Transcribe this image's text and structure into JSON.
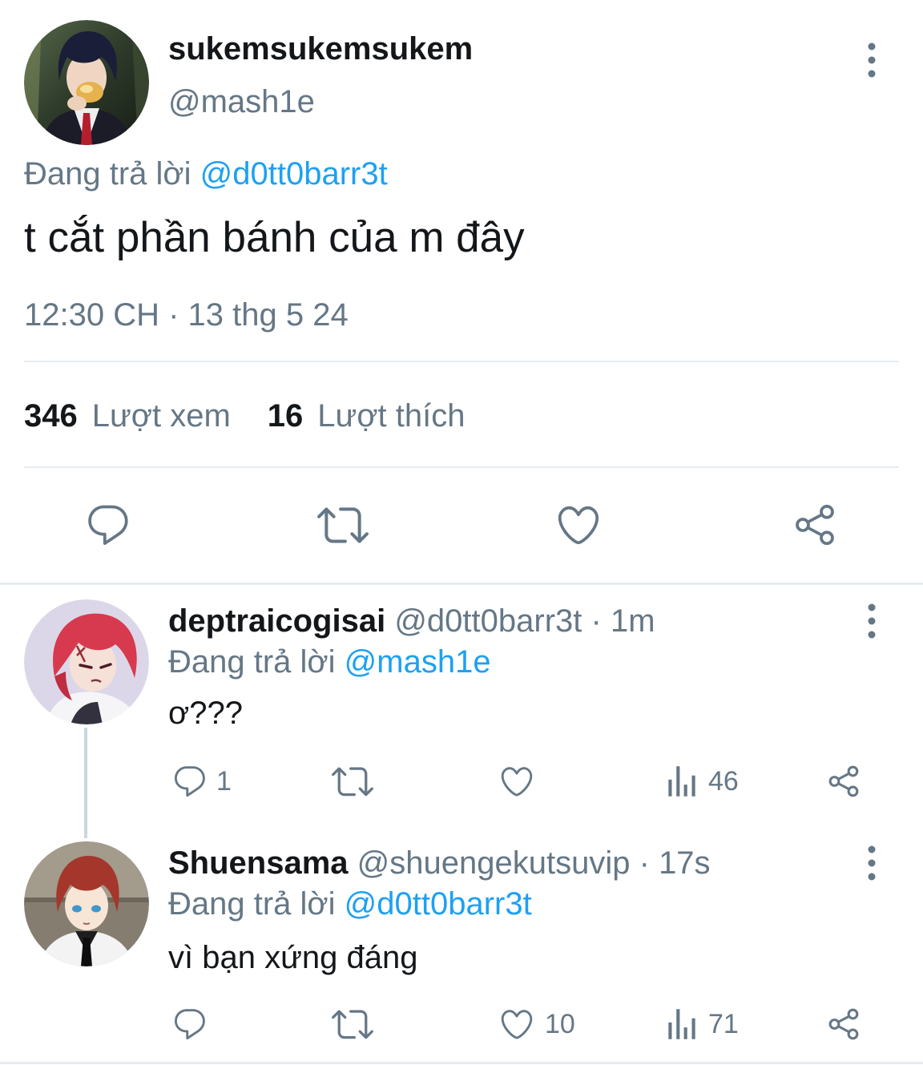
{
  "colors": {
    "text_primary": "#14171a",
    "text_secondary": "#657786",
    "link": "#1da1f2",
    "divider": "#e6ecf0",
    "icon": "#657786",
    "thread_line": "#ccd6dd"
  },
  "main_tweet": {
    "display_name": "sukemsukemsukem",
    "handle": "@mash1e",
    "reply_prefix": "Đang trả lời",
    "reply_to": "@d0tt0barr3t",
    "text": "t cắt phần bánh của m đây",
    "timestamp": "12:30 CH · 13 thg 5 24",
    "stats": {
      "views_count": "346",
      "views_label": "Lượt xem",
      "likes_count": "16",
      "likes_label": "Lượt thích"
    },
    "icons": [
      "more-vertical-icon",
      "reply-icon",
      "retweet-icon",
      "like-icon",
      "share-icon"
    ]
  },
  "replies": [
    {
      "display_name": "deptraicogisai",
      "handle": "@d0tt0barr3t",
      "separator": "·",
      "time": "1m",
      "reply_prefix": "Đang trả lời",
      "reply_to": "@mash1e",
      "text": "ơ???",
      "reply_count": "1",
      "view_count": "46",
      "icons": [
        "more-vertical-icon",
        "reply-icon",
        "retweet-icon",
        "like-icon",
        "views-icon",
        "share-icon"
      ]
    },
    {
      "display_name": "Shuensama",
      "handle": "@shuengekutsuvip",
      "separator": "·",
      "time": "17s",
      "reply_prefix": "Đang trả lời",
      "reply_to": "@d0tt0barr3t",
      "text": "vì bạn xứng đáng",
      "like_count": "10",
      "view_count": "71",
      "icons": [
        "more-vertical-icon",
        "reply-icon",
        "retweet-icon",
        "like-icon",
        "views-icon",
        "share-icon"
      ]
    }
  ]
}
